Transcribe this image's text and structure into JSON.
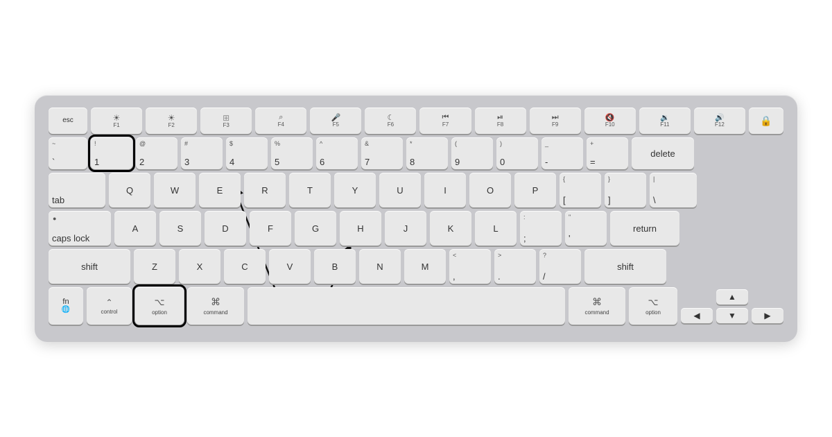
{
  "keyboard": {
    "rows": {
      "fn_row": {
        "keys": [
          {
            "id": "esc",
            "label": "esc",
            "sub": "",
            "icon": ""
          },
          {
            "id": "f1",
            "label": "F1",
            "sub": "",
            "icon": "☀"
          },
          {
            "id": "f2",
            "label": "F2",
            "sub": "",
            "icon": "☀"
          },
          {
            "id": "f3",
            "label": "F3",
            "sub": "",
            "icon": "⊞"
          },
          {
            "id": "f4",
            "label": "F4",
            "sub": "",
            "icon": "🔍"
          },
          {
            "id": "f5",
            "label": "F5",
            "sub": "",
            "icon": "🎤"
          },
          {
            "id": "f6",
            "label": "F6",
            "sub": "",
            "icon": "☾"
          },
          {
            "id": "f7",
            "label": "F7",
            "sub": "",
            "icon": "⏮"
          },
          {
            "id": "f8",
            "label": "F8",
            "sub": "",
            "icon": "⏯"
          },
          {
            "id": "f9",
            "label": "F9",
            "sub": "",
            "icon": "⏭"
          },
          {
            "id": "f10",
            "label": "F10",
            "sub": "",
            "icon": "🔇"
          },
          {
            "id": "f11",
            "label": "F11",
            "sub": "",
            "icon": "🔉"
          },
          {
            "id": "f12",
            "label": "F12",
            "sub": "",
            "icon": "🔊"
          },
          {
            "id": "lock",
            "label": "",
            "sub": "",
            "icon": "🔒"
          }
        ]
      }
    },
    "highlighted": {
      "key1": "1-key",
      "option_left": "option-left-key"
    }
  }
}
